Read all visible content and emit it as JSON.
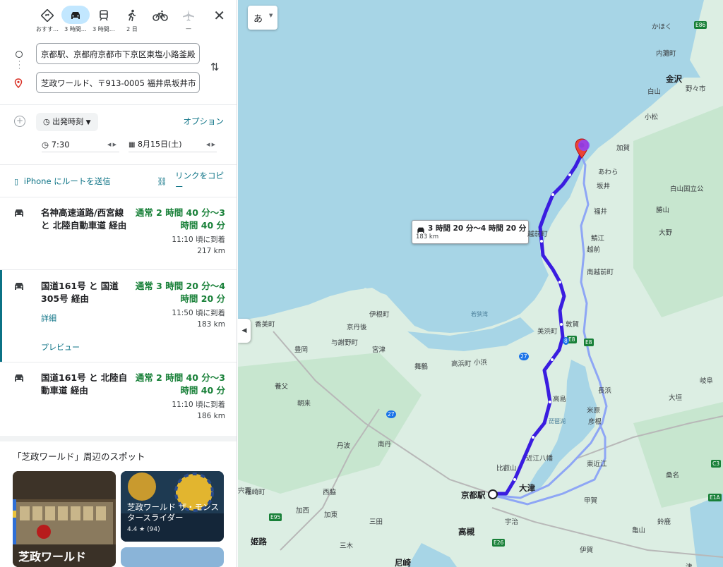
{
  "modes": [
    {
      "name": "best-mode",
      "label": "おすす…",
      "icon": "diamond-turn-icon"
    },
    {
      "name": "car-mode",
      "label": "3 時間…",
      "icon": "car-icon",
      "selected": true
    },
    {
      "name": "transit-mode",
      "label": "3 時間…",
      "icon": "train-icon"
    },
    {
      "name": "walk-mode",
      "label": "2 日",
      "icon": "walk-icon"
    },
    {
      "name": "bike-mode",
      "label": "",
      "icon": "bike-icon"
    },
    {
      "name": "flight-mode",
      "label": "—",
      "icon": "plane-icon"
    }
  ],
  "origin": "京都駅、京都府京都市下京区東塩小路釜殿",
  "destination": "芝政ワールド、〒913-0005 福井県坂井市",
  "depart_label": "出発時刻",
  "options_label": "オプション",
  "time_value": "7:30",
  "date_value": "8月15日(土)",
  "send_label": "iPhone にルートを送信",
  "copy_label": "リンクをコピー",
  "routes": [
    {
      "name": "名神高速道路/西宮線 と 北陸自動車道 経由",
      "duration": "通常 2 時間 40 分〜3 時間 40 分",
      "arrival": "11:10 頃に到着",
      "distance": "217 km"
    },
    {
      "name": "国道161号 と 国道305号 経由",
      "duration": "通常 3 時間 20 分〜4 時間 20 分",
      "arrival": "11:50 頃に到着",
      "distance": "183 km",
      "details": "詳細",
      "preview": "プレビュー"
    },
    {
      "name": "国道161号 と 北陸自動車道 経由",
      "duration": "通常 2 時間 40 分〜3 時間 40 分",
      "arrival": "11:10 頃に到着",
      "distance": "186 km"
    }
  ],
  "spots_title": "「芝政ワールド」周辺のスポット",
  "spot_cards": [
    {
      "title": "芝政ワールド"
    },
    {
      "title": "芝政ワールド ザ・モンスタースライダー",
      "rating": "4.4 ★ (94)"
    }
  ],
  "map": {
    "ime_label": "あ",
    "route_callout": {
      "duration": "3 時間 20 分〜4 時間 20 分",
      "distance": "183 km"
    },
    "labels": [
      {
        "t": "かほく"
      },
      {
        "t": "内灘町"
      },
      {
        "t": "金沢"
      },
      {
        "t": "野々市"
      },
      {
        "t": "白山"
      },
      {
        "t": "小松"
      },
      {
        "t": "加賀"
      },
      {
        "t": "あわら"
      },
      {
        "t": "坂井"
      },
      {
        "t": "白山国立公"
      },
      {
        "t": "福井"
      },
      {
        "t": "勝山"
      },
      {
        "t": "鯖江"
      },
      {
        "t": "大野"
      },
      {
        "t": "越前町"
      },
      {
        "t": "越前"
      },
      {
        "t": "南越前町"
      },
      {
        "t": "若狭湾"
      },
      {
        "t": "伊根町"
      },
      {
        "t": "京丹後"
      },
      {
        "t": "香美町"
      },
      {
        "t": "与謝野町"
      },
      {
        "t": "宮津"
      },
      {
        "t": "豊岡"
      },
      {
        "t": "舞鶴"
      },
      {
        "t": "高浜町"
      },
      {
        "t": "小浜"
      },
      {
        "t": "美浜町"
      },
      {
        "t": "敦賀"
      },
      {
        "t": "長浜"
      },
      {
        "t": "大垣"
      },
      {
        "t": "岐阜"
      },
      {
        "t": "高島"
      },
      {
        "t": "米原"
      },
      {
        "t": "彦根"
      },
      {
        "t": "琵琶湖"
      },
      {
        "t": "近江八幡"
      },
      {
        "t": "東近江"
      },
      {
        "t": "比叡山"
      },
      {
        "t": "大津"
      },
      {
        "t": "京都駅"
      },
      {
        "t": "甲賀"
      },
      {
        "t": "亀山"
      },
      {
        "t": "鈴鹿"
      },
      {
        "t": "桑名"
      },
      {
        "t": "養父"
      },
      {
        "t": "朝来"
      },
      {
        "t": "丹波"
      },
      {
        "t": "南丹"
      },
      {
        "t": "西脇"
      },
      {
        "t": "福崎町"
      },
      {
        "t": "加西"
      },
      {
        "t": "加東"
      },
      {
        "t": "三田"
      },
      {
        "t": "宍粟"
      },
      {
        "t": "高槻"
      },
      {
        "t": "宇治"
      },
      {
        "t": "姫路"
      },
      {
        "t": "三木"
      },
      {
        "t": "尼崎"
      },
      {
        "t": "伊賀"
      },
      {
        "t": "津"
      }
    ],
    "shields": [
      "E8",
      "E8",
      "E86",
      "E95",
      "C3",
      "E26",
      "E1A",
      "27",
      "27",
      "8"
    ]
  },
  "colors": {
    "route": "#3a1de0",
    "route_alt": "#8ea6f5",
    "water": "#a7d5e6",
    "land": "#dceee3",
    "green": "#b9e0c6",
    "accent": "#1a73e8"
  }
}
